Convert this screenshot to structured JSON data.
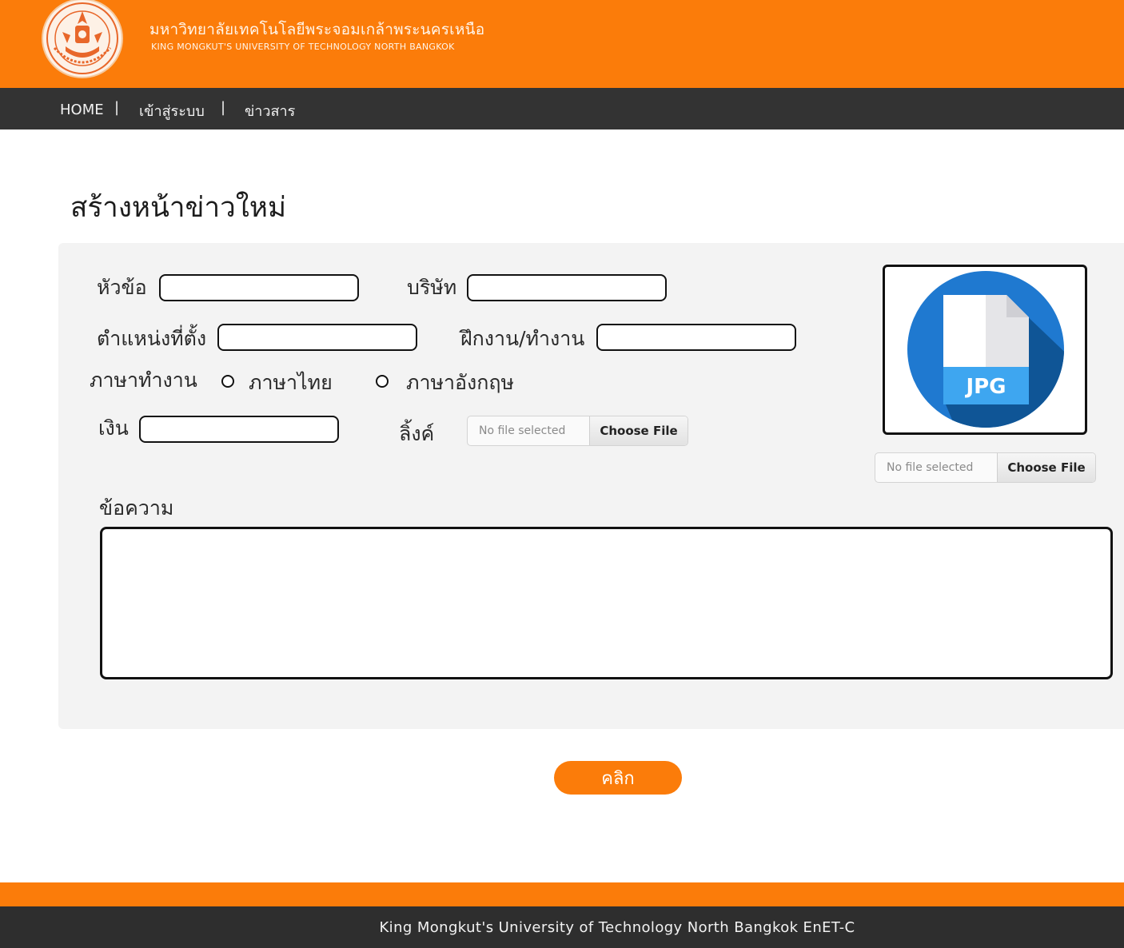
{
  "header": {
    "university_name_th": "มหาวิทยาลัยเทคโนโลยีพระจอมเกล้าพระนครเหนือ",
    "university_name_en": "KING MONGKUT'S UNIVERSITY OF TECHNOLOGY NORTH BANGKOK",
    "logo_icon": "university-seal-icon"
  },
  "nav": {
    "items": [
      {
        "label": "HOME"
      },
      {
        "label": "เข้าสู่ระบบ"
      },
      {
        "label": "ข่าวสาร"
      }
    ],
    "separator": "|"
  },
  "page": {
    "title": "สร้างหน้าข่าวใหม่"
  },
  "form": {
    "topic_label": "หัวข้อ",
    "topic_value": "",
    "company_label": "บริษัท",
    "company_value": "",
    "location_label": "ตำแหน่งที่ตั้ง",
    "location_value": "",
    "job_type_label": "ฝึกงาน/ทำงาน",
    "job_type_value": "",
    "language_label": "ภาษาทำงาน",
    "language_options": [
      {
        "label": "ภาษาไทย",
        "selected": false
      },
      {
        "label": "ภาษาอังกฤษ",
        "selected": false
      }
    ],
    "money_label": "เงิน",
    "money_value": "",
    "link_label": "ลิ้งค์",
    "link_file": {
      "status": "No file selected",
      "button": "Choose File"
    },
    "image_file": {
      "status": "No file selected",
      "button": "Choose File"
    },
    "image_preview": {
      "icon": "jpg-file-icon",
      "text": "JPG"
    },
    "message_label": "ข้อความ",
    "message_value": "",
    "submit_label": "คลิก"
  },
  "footer": {
    "text": "King Mongkut's University of Technology North Bangkok EnET-C"
  },
  "colors": {
    "accent": "#fb7c0a",
    "dark": "#333333",
    "panel": "#f3f3f3",
    "jpg_blue": "#1f79d0"
  }
}
